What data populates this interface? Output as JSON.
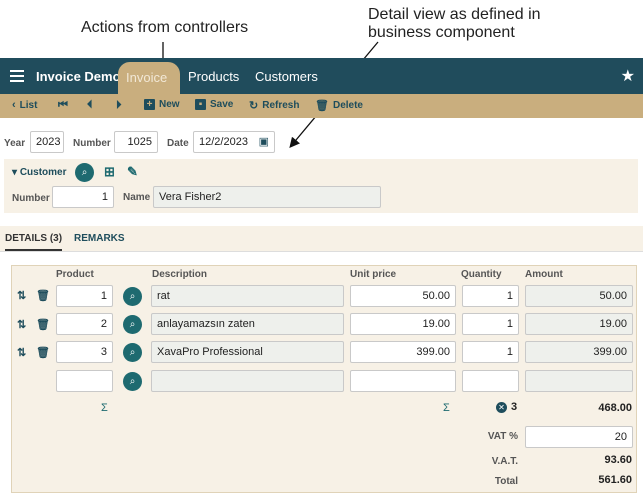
{
  "annotations": {
    "actions_note": "Actions from controllers",
    "detail_note_line1": "Detail view as defined in",
    "detail_note_line2": "business component"
  },
  "nav": {
    "app_title": "Invoice Demo :",
    "tabs": [
      {
        "label": "Invoice",
        "active": true
      },
      {
        "label": "Products",
        "active": false
      },
      {
        "label": "Customers",
        "active": false
      }
    ]
  },
  "toolbar": {
    "list": "List",
    "new": "New",
    "save": "Save",
    "refresh": "Refresh",
    "delete": "Delete"
  },
  "invoice": {
    "year_label": "Year",
    "year": "2023",
    "number_label": "Number",
    "number": "1025",
    "date_label": "Date",
    "date": "12/2/2023"
  },
  "customer": {
    "section_label": "Customer",
    "number_label": "Number",
    "number": "1",
    "name_label": "Name",
    "name": "Vera Fisher2"
  },
  "detail_tabs": [
    {
      "label": "DETAILS (3)",
      "active": true
    },
    {
      "label": "REMARKS",
      "active": false
    }
  ],
  "details": {
    "columns": [
      "Product",
      "Description",
      "Unit price",
      "Quantity",
      "Amount"
    ],
    "rows": [
      {
        "product": "1",
        "description": "rat",
        "unit_price": "50.00",
        "quantity": "1",
        "amount": "50.00"
      },
      {
        "product": "2",
        "description": "anlayamazsın zaten",
        "unit_price": "19.00",
        "quantity": "1",
        "amount": "19.00"
      },
      {
        "product": "3",
        "description": "XavaPro Professional",
        "unit_price": "399.00",
        "quantity": "1",
        "amount": "399.00"
      }
    ],
    "sigma": "Σ",
    "quantity_count": "3",
    "amount_sum": "468.00",
    "vat_label": "VAT %",
    "vat_value": "20",
    "vat_amount_label": "V.A.T.",
    "vat_amount": "93.60",
    "total_label": "Total",
    "total": "561.60"
  },
  "colors": {
    "nav_bg": "#204c5c",
    "accent": "#c9ae7e",
    "teal": "#1e6a70"
  }
}
